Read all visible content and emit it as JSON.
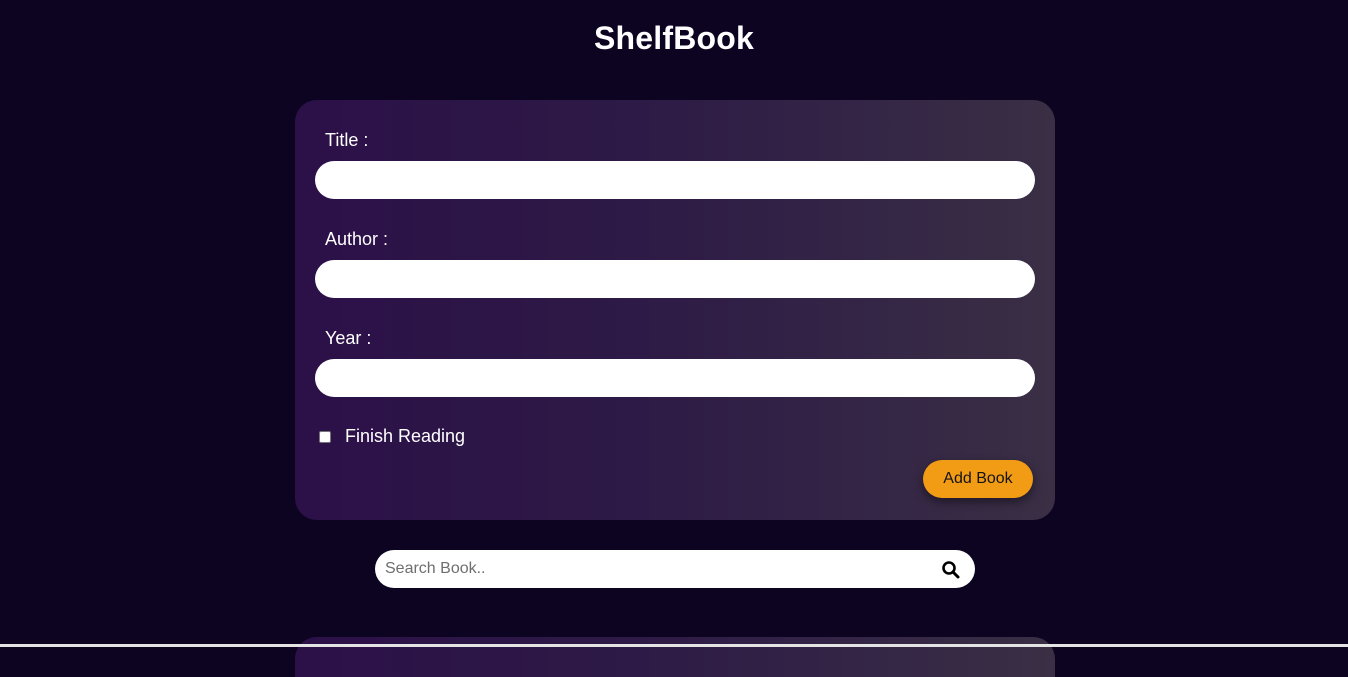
{
  "header": {
    "title": "ShelfBook"
  },
  "form": {
    "title_label": "Title :",
    "title_value": "",
    "author_label": "Author :",
    "author_value": "",
    "year_label": "Year :",
    "year_value": "",
    "finish_reading_label": "Finish Reading",
    "finish_reading_checked": false,
    "add_button_label": "Add Book"
  },
  "search": {
    "placeholder": "Search Book..",
    "value": "",
    "icon": "search-icon"
  },
  "colors": {
    "background": "#0d0422",
    "card_gradient_start": "#2c1048",
    "card_gradient_end": "#3a2f45",
    "accent_button": "#f29b15"
  }
}
